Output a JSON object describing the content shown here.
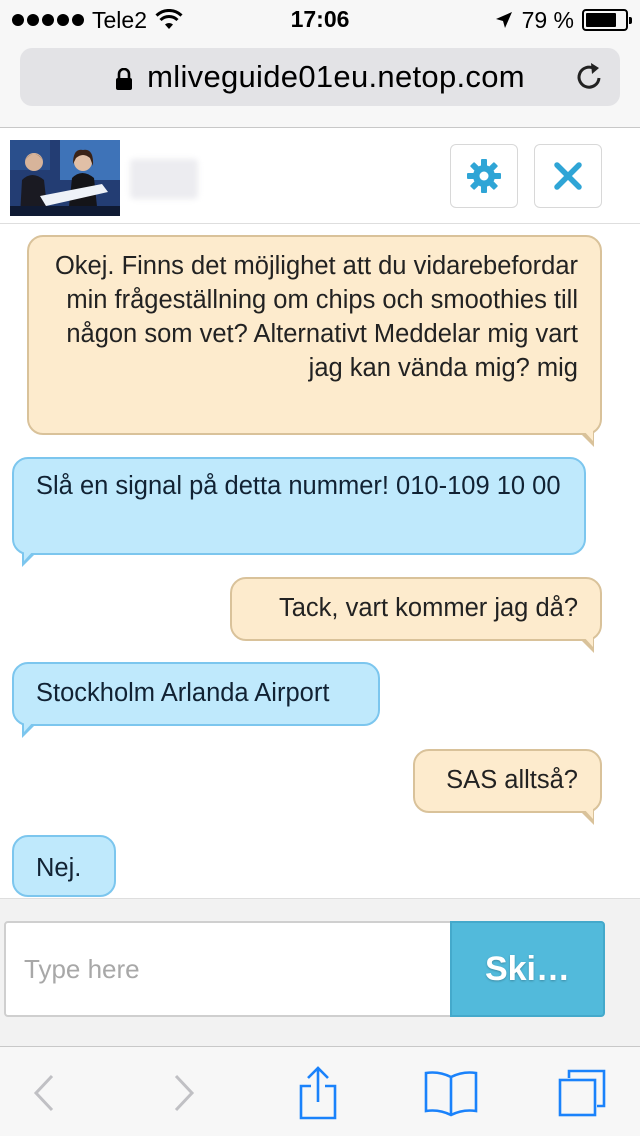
{
  "status_bar": {
    "carrier": "Tele2",
    "time": "17:06",
    "battery_percent": "79 %",
    "battery_level": 0.79,
    "icons": [
      "signal-dots-icon",
      "wifi-icon",
      "location-arrow-icon",
      "battery-icon"
    ]
  },
  "browser": {
    "url": "mliveguide01eu.netop.com",
    "icons": [
      "lock-icon",
      "reload-icon"
    ]
  },
  "chat": {
    "header": {
      "icons": [
        "gear-icon",
        "close-icon"
      ]
    },
    "messages": [
      {
        "from": "user",
        "text": "Okej. Finns det möjlighet att du vidarebefordar min frågeställning om chips och smoothies till någon som vet? Alternativt Meddelar mig vart jag kan vända mig? mig"
      },
      {
        "from": "agent",
        "text": "Slå en signal på detta nummer! 010-109 10 00"
      },
      {
        "from": "user",
        "text": "Tack, vart kommer jag då?"
      },
      {
        "from": "agent",
        "text": "Stockholm Arlanda Airport"
      },
      {
        "from": "user",
        "text": "SAS alltså?"
      },
      {
        "from": "agent",
        "text": "Nej."
      }
    ],
    "composer": {
      "placeholder": "Type here",
      "value": "",
      "send_label": "Ski…"
    }
  },
  "toolbar": {
    "icons": [
      "back-icon",
      "forward-icon",
      "share-icon",
      "bookmarks-icon",
      "tabs-icon"
    ]
  },
  "colors": {
    "user_bubble": "#fdebcd",
    "agent_bubble": "#bfe9fc",
    "accent": "#52badb",
    "ios_blue": "#1a82fb"
  }
}
